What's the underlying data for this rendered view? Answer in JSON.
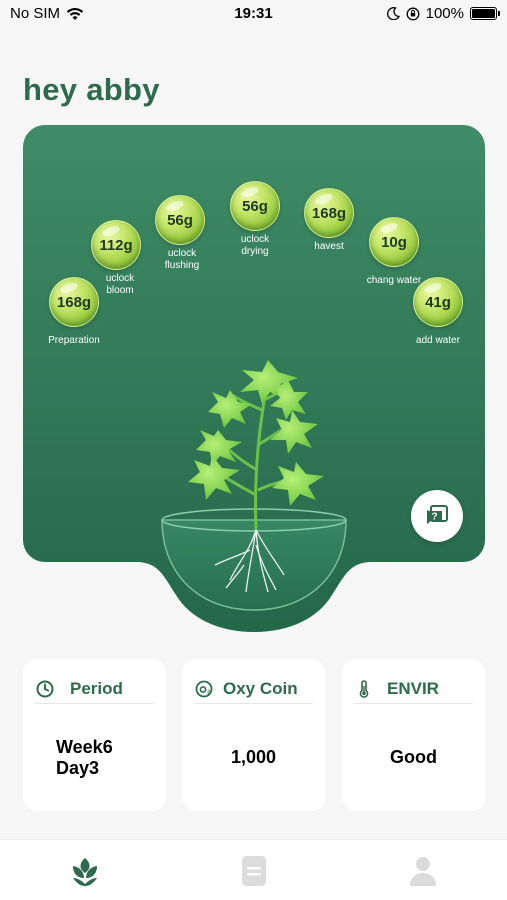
{
  "status_bar": {
    "carrier": "No SIM",
    "time": "19:31",
    "battery": "100%",
    "wifi_icon": "wifi-icon",
    "moon_icon": "moon-icon",
    "lock_icon": "orientation-lock-icon"
  },
  "greeting": "hey abby",
  "stages": [
    {
      "value": "168g",
      "label": "Preparation"
    },
    {
      "value": "112g",
      "label": "uclock bloom"
    },
    {
      "value": "56g",
      "label": "uclock flushing"
    },
    {
      "value": "56g",
      "label": "uclock drying"
    },
    {
      "value": "168g",
      "label": "havest"
    },
    {
      "value": "10g",
      "label": "chang water"
    },
    {
      "value": "41g",
      "label": "add water"
    }
  ],
  "help_icon": "question-chat-icon",
  "cards": {
    "period": {
      "title": "Period",
      "value_line1": "Week6",
      "value_line2": "Day3",
      "icon": "clock-icon"
    },
    "coin": {
      "title": "Oxy Coin",
      "value": "1,000",
      "icon": "coin-icon"
    },
    "envir": {
      "title": "ENVIR",
      "value": "Good",
      "icon": "thermometer-icon"
    }
  },
  "tabs": [
    {
      "name": "plant",
      "icon": "plant-icon",
      "active": true
    },
    {
      "name": "records",
      "icon": "document-icon",
      "active": false
    },
    {
      "name": "profile",
      "icon": "profile-icon",
      "active": false
    }
  ],
  "colors": {
    "brand_green": "#2e6a4e",
    "card_green_top": "#3d8a64",
    "card_green_bottom": "#24674a",
    "bubble": "#b5dc55"
  }
}
